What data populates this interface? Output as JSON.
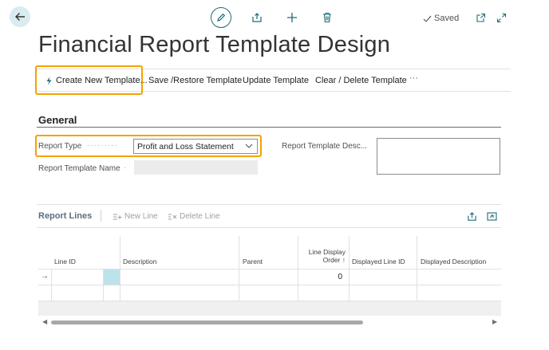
{
  "header": {
    "saved_label": "Saved",
    "icons": [
      "back-arrow-icon",
      "edit-pencil-icon",
      "share-icon",
      "add-icon",
      "delete-icon",
      "check-icon",
      "open-new-window-icon",
      "expand-icon"
    ]
  },
  "page": {
    "title": "Financial Report Template Design"
  },
  "actions": {
    "create_new": "Create New Template...",
    "save_restore": "Save /Restore Template",
    "update": "Update Template",
    "clear_delete": "Clear / Delete Template",
    "more": "···"
  },
  "general": {
    "title": "General",
    "report_type_label": "Report Type",
    "report_type_value": "Profit and Loss Statement",
    "report_template_name_label": "Report Template Name",
    "report_template_name_value": "",
    "report_template_desc_label": "Report Template Desc...",
    "report_template_desc_value": ""
  },
  "report_lines": {
    "title": "Report Lines",
    "new_line": "New Line",
    "delete_line": "Delete Line",
    "columns": {
      "line_id": "Line ID",
      "description": "Description",
      "parent": "Parent",
      "line_display_order_1": "Line Display",
      "line_display_order_2": "Order ↑",
      "displayed_line_id": "Displayed Line ID",
      "displayed_description": "Displayed Description"
    },
    "rows": [
      {
        "indicator": "→",
        "line_id": "",
        "description": "",
        "parent": "",
        "line_display_order": "0",
        "displayed_line_id": "",
        "displayed_description": ""
      },
      {
        "indicator": "",
        "line_id": "",
        "description": "",
        "parent": "",
        "line_display_order": "",
        "displayed_line_id": "",
        "displayed_description": ""
      }
    ]
  },
  "colors": {
    "accent": "#1d6b77",
    "highlight": "#f4a300",
    "back_button_bg": "#d9ecef"
  }
}
